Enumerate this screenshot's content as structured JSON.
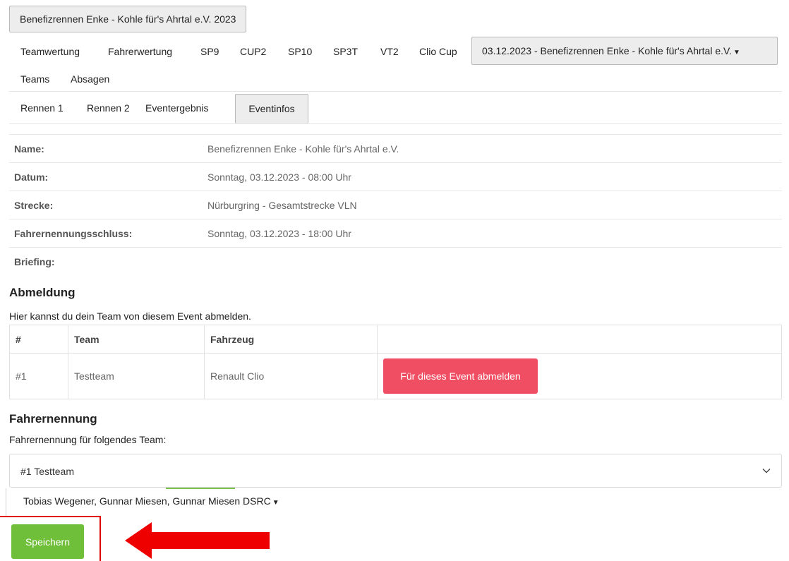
{
  "header": {
    "event_button": "Benefizrennen Enke - Kohle für's Ahrtal e.V. 2023"
  },
  "nav": {
    "tabs": [
      "Teamwertung",
      "Fahrerwertung",
      "SP9",
      "CUP2",
      "SP10",
      "SP3T",
      "VT2",
      "Clio Cup"
    ],
    "event_select": "03.12.2023 - Benefizrennen Enke - Kohle für's Ahrtal e.V.",
    "tabs_row2": [
      "Teams",
      "Absagen"
    ]
  },
  "subnav": {
    "tabs": [
      "Rennen 1",
      "Rennen 2",
      "Eventergebnis"
    ],
    "active_tab": "Eventinfos"
  },
  "info": {
    "rows": [
      {
        "label": "Name:",
        "value": "Benefizrennen Enke - Kohle für's Ahrtal e.V."
      },
      {
        "label": "Datum:",
        "value": "Sonntag, 03.12.2023 - 08:00 Uhr"
      },
      {
        "label": "Strecke:",
        "value": "Nürburgring - Gesamtstrecke VLN"
      },
      {
        "label": "Fahrernennungsschluss:",
        "value": "Sonntag, 03.12.2023 - 18:00 Uhr"
      },
      {
        "label": "Briefing:",
        "value": ""
      }
    ]
  },
  "abmeldung": {
    "heading": "Abmeldung",
    "description": "Hier kannst du dein Team von diesem Event abmelden.",
    "columns": [
      "#",
      "Team",
      "Fahrzeug",
      ""
    ],
    "rows": [
      {
        "num": "#1",
        "team": "Testteam",
        "car": "Renault Clio",
        "action": "Für dieses Event abmelden"
      }
    ]
  },
  "fahrernennung": {
    "heading": "Fahrernennung",
    "description": "Fahrernennung für folgendes Team:",
    "team_select": "#1 Testteam",
    "drivers": "Tobias Wegener, Gunnar Miesen, Gunnar Miesen DSRC",
    "save_label": "Speichern"
  },
  "colors": {
    "danger": "#f04e63",
    "success": "#6fbf3a",
    "annotation": "#e00000"
  }
}
